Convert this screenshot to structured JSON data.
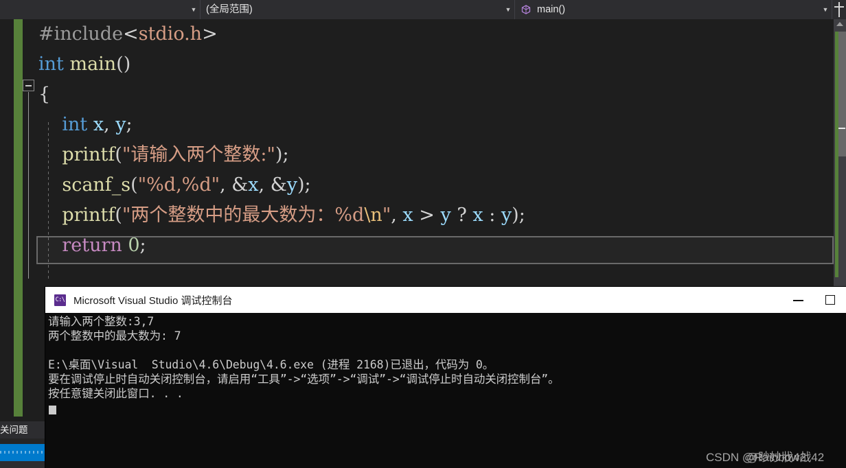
{
  "nav_bar": {
    "project_combo": {
      "value": "",
      "icon": "chevron-down-icon"
    },
    "scope_combo": {
      "value": "(全局范围)",
      "icon": "chevron-down-icon"
    },
    "member_combo": {
      "value": "main()",
      "icon": "method-icon"
    },
    "splitter": "split-window-icon"
  },
  "editor": {
    "collapse_toggle": "−",
    "code_lines": [
      {
        "id": "line-include",
        "tokens": [
          {
            "t": "#include",
            "c": "pre"
          },
          {
            "t": "<",
            "c": "punct"
          },
          {
            "t": "stdio.h",
            "c": "inc"
          },
          {
            "t": ">",
            "c": "punct"
          }
        ]
      },
      {
        "id": "line-main",
        "tokens": [
          {
            "t": "int",
            "c": "kw"
          },
          {
            "t": " ",
            "c": "punct"
          },
          {
            "t": "main",
            "c": "fn"
          },
          {
            "t": "()",
            "c": "brace"
          }
        ]
      },
      {
        "id": "line-open-brace",
        "tokens": [
          {
            "t": "{",
            "c": "brace"
          }
        ]
      },
      {
        "id": "line-decl",
        "tokens": [
          {
            "t": "    ",
            "c": "punct"
          },
          {
            "t": "int",
            "c": "kw"
          },
          {
            "t": " ",
            "c": "punct"
          },
          {
            "t": "x",
            "c": "var"
          },
          {
            "t": ",",
            "c": "punct"
          },
          {
            "t": " ",
            "c": "punct"
          },
          {
            "t": "y",
            "c": "var"
          },
          {
            "t": ";",
            "c": "punct"
          }
        ]
      },
      {
        "id": "line-printf-prompt",
        "tokens": [
          {
            "t": "    ",
            "c": "punct"
          },
          {
            "t": "printf",
            "c": "fn"
          },
          {
            "t": "(",
            "c": "brace"
          },
          {
            "t": "\"请输入两个整数:\"",
            "c": "str"
          },
          {
            "t": ")",
            "c": "brace"
          },
          {
            "t": ";",
            "c": "punct"
          }
        ]
      },
      {
        "id": "line-scanf",
        "tokens": [
          {
            "t": "    ",
            "c": "punct"
          },
          {
            "t": "scanf_s",
            "c": "fn"
          },
          {
            "t": "(",
            "c": "brace"
          },
          {
            "t": "\"%d,%d\"",
            "c": "str"
          },
          {
            "t": ",",
            "c": "punct"
          },
          {
            "t": " ",
            "c": "punct"
          },
          {
            "t": "&",
            "c": "punct"
          },
          {
            "t": "x",
            "c": "var"
          },
          {
            "t": ",",
            "c": "punct"
          },
          {
            "t": " ",
            "c": "punct"
          },
          {
            "t": "&",
            "c": "punct"
          },
          {
            "t": "y",
            "c": "var"
          },
          {
            "t": ")",
            "c": "brace"
          },
          {
            "t": ";",
            "c": "punct"
          }
        ]
      },
      {
        "id": "line-printf-max",
        "tokens": [
          {
            "t": "    ",
            "c": "punct"
          },
          {
            "t": "printf",
            "c": "fn"
          },
          {
            "t": "(",
            "c": "brace"
          },
          {
            "t": "\"两个整数中的最大数为：%d",
            "c": "str"
          },
          {
            "t": "\\n",
            "c": "esc"
          },
          {
            "t": "\"",
            "c": "str"
          },
          {
            "t": ",",
            "c": "punct"
          },
          {
            "t": " ",
            "c": "punct"
          },
          {
            "t": "x",
            "c": "var"
          },
          {
            "t": " ",
            "c": "punct"
          },
          {
            "t": ">",
            "c": "punct"
          },
          {
            "t": " ",
            "c": "punct"
          },
          {
            "t": "y",
            "c": "var"
          },
          {
            "t": " ? ",
            "c": "punct"
          },
          {
            "t": "x",
            "c": "var"
          },
          {
            "t": " : ",
            "c": "punct"
          },
          {
            "t": "y",
            "c": "var"
          },
          {
            "t": ")",
            "c": "brace"
          },
          {
            "t": ";",
            "c": "punct"
          }
        ]
      },
      {
        "id": "line-return",
        "tokens": [
          {
            "t": "    ",
            "c": "punct"
          },
          {
            "t": "return",
            "c": "ret"
          },
          {
            "t": " ",
            "c": "punct"
          },
          {
            "t": "0",
            "c": "num"
          },
          {
            "t": ";",
            "c": "punct"
          }
        ]
      }
    ]
  },
  "console": {
    "title": "Microsoft Visual Studio 调试控制台",
    "app_icon_text": "C:\\",
    "minimize_label": "最小化",
    "maximize_label": "最大化",
    "output_lines": [
      "请输入两个整数:3,7",
      "两个整数中的最大数为: 7",
      "",
      "E:\\桌面\\Visual  Studio\\4.6\\Debug\\4.6.exe (进程 2168)已退出，代码为 0。",
      "要在调试停止时自动关闭控制台，请启用“工具”->“选项”->“调试”->“调试停止时自动关闭控制台”。",
      "按任意键关闭此窗口. . ."
    ]
  },
  "bottom_panel": {
    "tab_label": "关问题"
  },
  "watermark": {
    "prefix": "CSDN ",
    "handle_a": "@Rainbow战42",
    "handle_b": "@眇妙戕42"
  },
  "colors": {
    "editor_bg": "#1e1e1e",
    "nav_bg": "#2d2d30",
    "change_bar_green": "#57813a",
    "console_bg": "#0c0c0c",
    "console_title_bg": "#ffffff",
    "status_bar_blue": "#007acc",
    "keyword_blue": "#569cd6",
    "string_salmon": "#d69d85",
    "function_yellow": "#dcdcaa",
    "return_purple": "#c586c0",
    "number_green": "#b5cea8",
    "variable_lightblue": "#9cdcfe"
  }
}
